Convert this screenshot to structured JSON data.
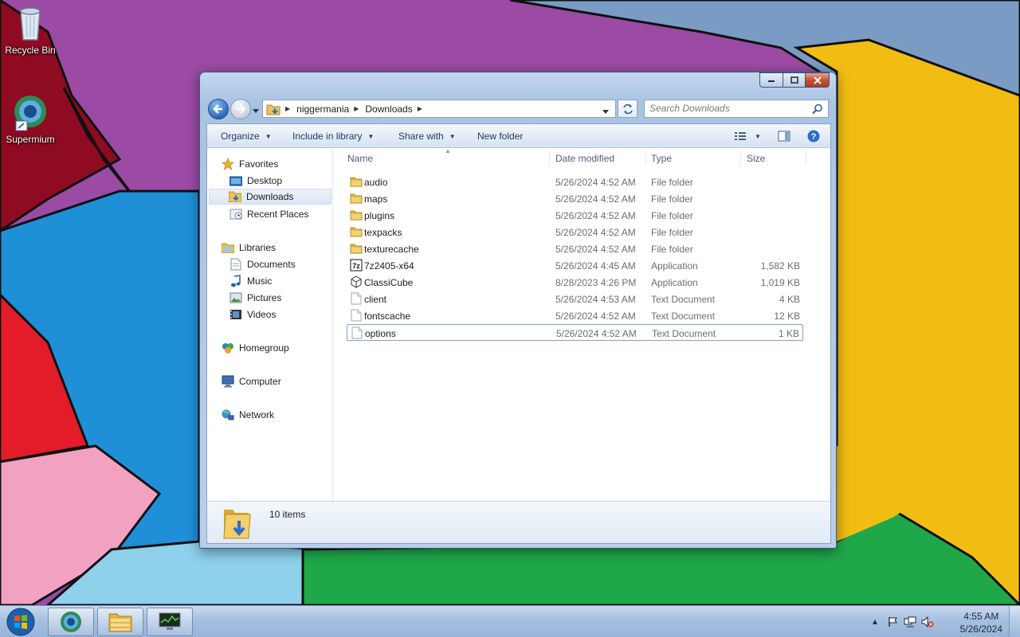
{
  "desktop": {
    "icons": [
      {
        "label": "Recycle Bin",
        "icon": "recycle-bin-icon"
      },
      {
        "label": "Supermium",
        "icon": "supermium-browser-icon"
      }
    ]
  },
  "window": {
    "breadcrumb": [
      "niggermania",
      "Downloads"
    ],
    "search_placeholder": "Search Downloads",
    "toolbar": {
      "organize": "Organize",
      "include_in_library": "Include in library",
      "share_with": "Share with",
      "new_folder": "New folder"
    },
    "nav": {
      "favorites": "Favorites",
      "desktop": "Desktop",
      "downloads": "Downloads",
      "recent_places": "Recent Places",
      "libraries": "Libraries",
      "documents": "Documents",
      "music": "Music",
      "pictures": "Pictures",
      "videos": "Videos",
      "homegroup": "Homegroup",
      "computer": "Computer",
      "network": "Network",
      "selected": "Downloads"
    },
    "columns": {
      "name": "Name",
      "date": "Date modified",
      "type": "Type",
      "size": "Size"
    },
    "files": [
      {
        "name": "audio",
        "date": "5/26/2024 4:52 AM",
        "type": "File folder",
        "size": "",
        "icon": "folder-icon"
      },
      {
        "name": "maps",
        "date": "5/26/2024 4:52 AM",
        "type": "File folder",
        "size": "",
        "icon": "folder-icon"
      },
      {
        "name": "plugins",
        "date": "5/26/2024 4:52 AM",
        "type": "File folder",
        "size": "",
        "icon": "folder-icon"
      },
      {
        "name": "texpacks",
        "date": "5/26/2024 4:52 AM",
        "type": "File folder",
        "size": "",
        "icon": "folder-icon"
      },
      {
        "name": "texturecache",
        "date": "5/26/2024 4:52 AM",
        "type": "File folder",
        "size": "",
        "icon": "folder-icon"
      },
      {
        "name": "7z2405-x64",
        "date": "5/26/2024 4:45 AM",
        "type": "Application",
        "size": "1,582 KB",
        "icon": "7zip-installer-icon"
      },
      {
        "name": "ClassiCube",
        "date": "8/28/2023 4:26 PM",
        "type": "Application",
        "size": "1,019 KB",
        "icon": "classicube-app-icon"
      },
      {
        "name": "client",
        "date": "5/26/2024 4:53 AM",
        "type": "Text Document",
        "size": "4 KB",
        "icon": "text-document-icon"
      },
      {
        "name": "fontscache",
        "date": "5/26/2024 4:52 AM",
        "type": "Text Document",
        "size": "12 KB",
        "icon": "text-document-icon"
      },
      {
        "name": "options",
        "date": "5/26/2024 4:52 AM",
        "type": "Text Document",
        "size": "1 KB",
        "icon": "text-document-icon"
      }
    ],
    "focused_item": "options",
    "status": {
      "item_count": "10 items"
    }
  },
  "taskbar": {
    "apps": [
      {
        "name": "Supermium",
        "icon": "supermium-browser-icon"
      },
      {
        "name": "Windows Explorer",
        "icon": "file-explorer-icon"
      },
      {
        "name": "Task Manager",
        "icon": "task-manager-icon"
      }
    ],
    "clock": {
      "time": "4:55 AM",
      "date": "5/26/2024"
    }
  },
  "colors": {
    "window_frame": "#a9c3e3",
    "selection": "#dbe6f4",
    "folder": "#e9c45a",
    "taskbar": "#a7c0e0"
  }
}
